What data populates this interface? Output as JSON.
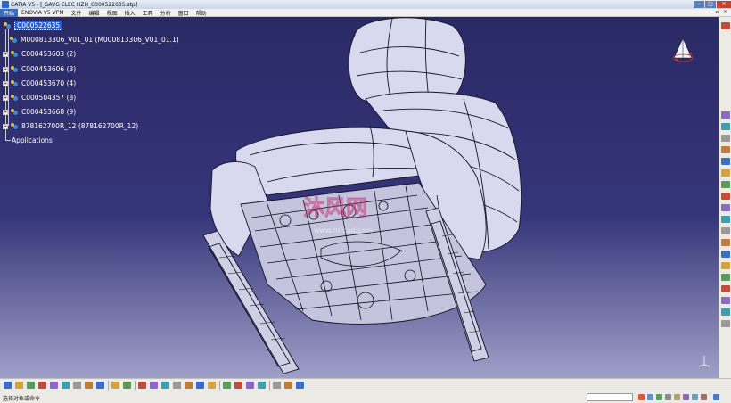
{
  "window": {
    "title": "CATIA V5 - [_SAVG ELEC HZH_C000522635.stp]"
  },
  "menu": {
    "items": [
      "开始",
      "ENOVIA V5 VPM",
      "文件",
      "编辑",
      "视图",
      "插入",
      "工具",
      "分析",
      "窗口",
      "帮助"
    ],
    "active_index": 0
  },
  "tree": {
    "root": "C000522635",
    "nodes": [
      "M000813306_V01_01 (M000813306_V01_01.1)",
      "C000453603 (2)",
      "C000453606 (3)",
      "C000453670 (4)",
      "C000504357 (8)",
      "C000453668 (9)",
      "878162700R_12 (878162700R_12)"
    ],
    "applications": "Applications"
  },
  "watermark": {
    "text": "沐风网",
    "url": "www.mfcad.com"
  },
  "statusbar": {
    "prompt": "选择对象或命令"
  },
  "colors": {
    "viewport_top": "#2a2a66",
    "viewport_bottom": "#9fa0c8",
    "selection": "#2b5fd0",
    "model_fill": "#d8d8ee",
    "model_line": "#15152a"
  },
  "icons": {
    "bottom_toolbar": [
      "new-icon",
      "open-icon",
      "save-icon",
      "print-icon",
      "cut-icon",
      "copy-icon",
      "paste-icon",
      "undo-icon",
      "redo-icon",
      "whats-this-icon",
      "formula-icon",
      "fit-all-icon",
      "pan-icon",
      "rotate-icon",
      "zoom-in-icon",
      "zoom-out-icon",
      "normal-view-icon",
      "iso-view-icon",
      "shading-icon",
      "hide-show-icon",
      "swap-space-icon",
      "measure-icon",
      "catalog-icon",
      "snap-icon",
      "update-icon"
    ],
    "right_toolbar": [
      "product-structure-icon",
      "new-component-icon",
      "new-product-icon",
      "existing-component-icon",
      "replace-component-icon",
      "graph-tree-icon",
      "generate-numbering-icon",
      "manipulate-icon",
      "explode-icon",
      "stop-manipulate-icon",
      "fix-icon",
      "coincidence-icon",
      "contact-icon",
      "offset-icon",
      "angle-icon",
      "clash-icon",
      "sectioning-icon",
      "distance-icon",
      "annotation-icon",
      "scene-icon"
    ]
  }
}
